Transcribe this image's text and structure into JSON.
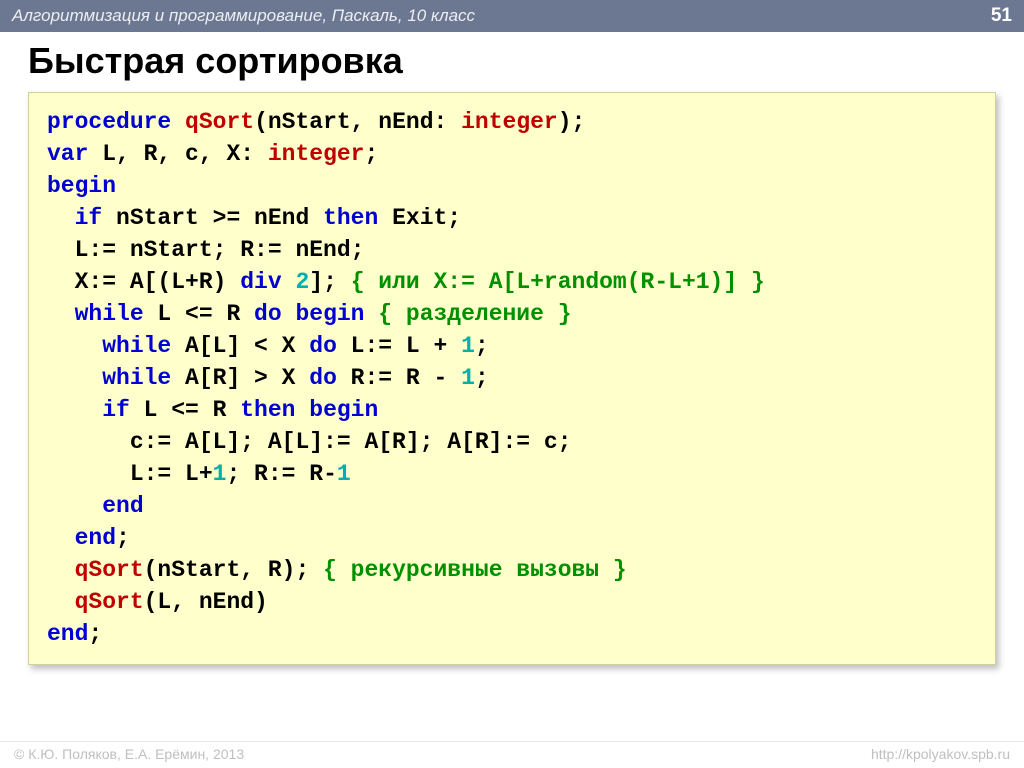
{
  "header": {
    "breadcrumb": "Алгоритмизация и программирование, Паскаль, 10 класс",
    "page_number": "51"
  },
  "title": "Быстрая сортировка",
  "code": {
    "l01_procedure": "procedure",
    "l01_name": "qSort",
    "l01_params": "(nStart, nEnd: ",
    "l01_type": "integer",
    "l01_end": ");",
    "l02_var": "var",
    "l02_decl": " L, R, c, X: ",
    "l02_type": "integer",
    "l02_semi": ";",
    "l03_begin": "begin",
    "l04_if": "if",
    "l04_cond": " nStart >= nEnd ",
    "l04_then": "then",
    "l04_exit": " Exit;",
    "l05": "  L:= nStart; R:= nEnd;",
    "l06_a": "  X:= A[(L+R)",
    "l06_div": " div ",
    "l06_num": "2",
    "l06_b": "]; ",
    "l06_cmt": "{ или X:= A[L+random(R-L+1)] }",
    "l07_while": "while",
    "l07_cond": " L <= R ",
    "l07_do": "do",
    "l07_begin": " begin",
    "l07_cmt": " { разделение }",
    "l08_while": "while",
    "l08_body": " A[L] < X ",
    "l08_do": "do",
    "l08_rest": " L:= L + ",
    "l08_num": "1",
    "l08_semi": ";",
    "l09_while": "while",
    "l09_body": " A[R] > X ",
    "l09_do": "do",
    "l09_rest": " R:= R - ",
    "l09_num": "1",
    "l09_semi": ";",
    "l10_if": "if",
    "l10_cond": " L <= R ",
    "l10_then": "then",
    "l10_begin": " begin",
    "l11": "      c:= A[L]; A[L]:= A[R]; A[R]:= c;",
    "l12_a": "      L:= L+",
    "l12_n1": "1",
    "l12_b": "; R:= R-",
    "l12_n2": "1",
    "l13_end": "end",
    "l14_end": "end",
    "l14_semi": ";",
    "l15_name": "qSort",
    "l15_args": "(nStart, R); ",
    "l15_cmt": "{ рекурсивные вызовы }",
    "l16_name": "qSort",
    "l16_args": "(L, nEnd)",
    "l17_end": "end",
    "l17_semi": ";"
  },
  "footer": {
    "left": "© К.Ю. Поляков, Е.А. Ерёмин, 2013",
    "right": "http://kpolyakov.spb.ru"
  }
}
